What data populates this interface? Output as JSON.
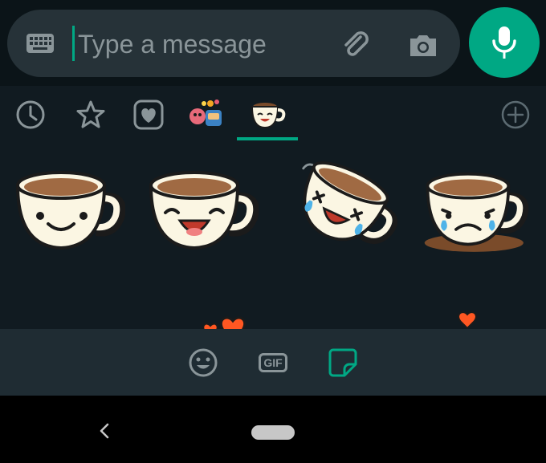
{
  "composer": {
    "placeholder": "Type a message",
    "keyboard_icon": "keyboard-icon",
    "attach_icon": "paperclip-icon",
    "camera_icon": "camera-icon",
    "mic_icon": "microphone-icon"
  },
  "sticker_tabs": [
    {
      "name": "recent",
      "icon": "clock-icon"
    },
    {
      "name": "favorites",
      "icon": "star-icon"
    },
    {
      "name": "hearts",
      "icon": "heart-icon"
    },
    {
      "name": "pack-1",
      "icon": "sticker-pack-thumbnail"
    },
    {
      "name": "coffee-pack",
      "icon": "coffee-cup-thumbnail",
      "selected": true
    },
    {
      "name": "add",
      "icon": "plus-circle-icon"
    }
  ],
  "bottom_bar": {
    "emoji_icon": "smiley-icon",
    "gif_label": "GIF",
    "sticker_icon": "sticker-icon"
  },
  "colors": {
    "accent": "#00a884",
    "panel_bg": "#111b21",
    "bar_bg": "#1f2c33",
    "input_bg": "#263238"
  }
}
